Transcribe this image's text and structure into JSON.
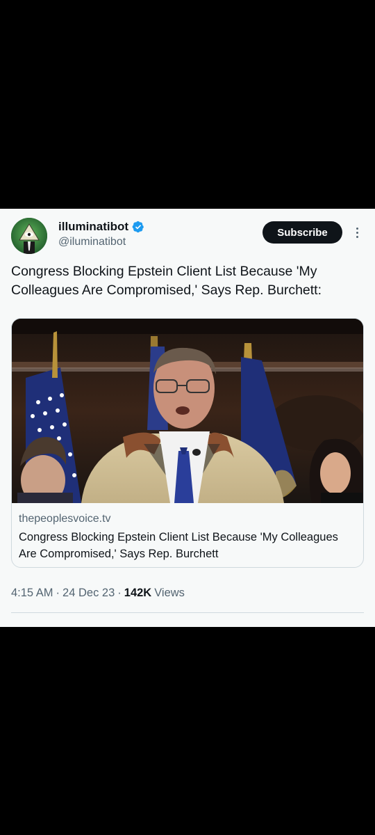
{
  "tweet": {
    "author": {
      "display_name": "illuminatibot",
      "handle": "@iluminatibot",
      "verified_icon": "verified-badge-icon",
      "avatar_icon": "illuminati-eye-avatar"
    },
    "subscribe_label": "Subscribe",
    "more_icon": "more-options-icon",
    "text": "Congress Blocking Epstein Client List Because 'My Colleagues Are Compromised,' Says Rep. Burchett:",
    "card": {
      "image": "press-conference-photo",
      "domain": "thepeoplesvoice.tv",
      "title": "Congress Blocking Epstein Client List Because 'My Colleagues Are Compromised,' Says Rep. Burchett"
    },
    "meta": {
      "time": "4:15 AM",
      "sep1": "·",
      "date": "24 Dec 23",
      "sep2": "·",
      "views_count": "142K",
      "views_label": "Views"
    }
  },
  "colors": {
    "background": "#000000",
    "card_bg": "#f7f9f9",
    "text_primary": "#0f1419",
    "text_secondary": "#536471",
    "verified": "#1d9bf0",
    "subscribe_bg": "#0f1419"
  }
}
